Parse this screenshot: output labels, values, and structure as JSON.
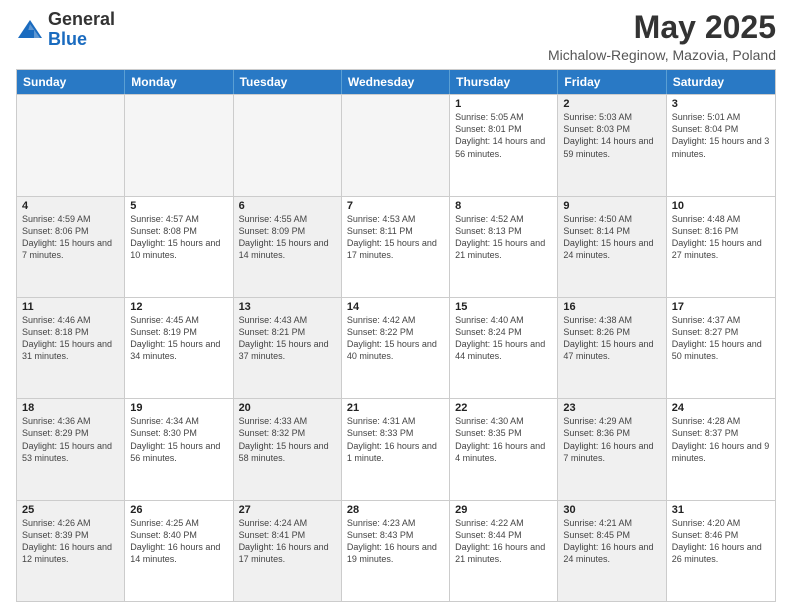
{
  "header": {
    "logo_general": "General",
    "logo_blue": "Blue",
    "month_year": "May 2025",
    "location": "Michalow-Reginow, Mazovia, Poland"
  },
  "days_of_week": [
    "Sunday",
    "Monday",
    "Tuesday",
    "Wednesday",
    "Thursday",
    "Friday",
    "Saturday"
  ],
  "weeks": [
    [
      {
        "day": "",
        "info": "",
        "shaded": true
      },
      {
        "day": "",
        "info": "",
        "shaded": true
      },
      {
        "day": "",
        "info": "",
        "shaded": true
      },
      {
        "day": "",
        "info": "",
        "shaded": true
      },
      {
        "day": "1",
        "info": "Sunrise: 5:05 AM\nSunset: 8:01 PM\nDaylight: 14 hours\nand 56 minutes.",
        "shaded": false
      },
      {
        "day": "2",
        "info": "Sunrise: 5:03 AM\nSunset: 8:03 PM\nDaylight: 14 hours\nand 59 minutes.",
        "shaded": true
      },
      {
        "day": "3",
        "info": "Sunrise: 5:01 AM\nSunset: 8:04 PM\nDaylight: 15 hours\nand 3 minutes.",
        "shaded": false
      }
    ],
    [
      {
        "day": "4",
        "info": "Sunrise: 4:59 AM\nSunset: 8:06 PM\nDaylight: 15 hours\nand 7 minutes.",
        "shaded": true
      },
      {
        "day": "5",
        "info": "Sunrise: 4:57 AM\nSunset: 8:08 PM\nDaylight: 15 hours\nand 10 minutes.",
        "shaded": false
      },
      {
        "day": "6",
        "info": "Sunrise: 4:55 AM\nSunset: 8:09 PM\nDaylight: 15 hours\nand 14 minutes.",
        "shaded": true
      },
      {
        "day": "7",
        "info": "Sunrise: 4:53 AM\nSunset: 8:11 PM\nDaylight: 15 hours\nand 17 minutes.",
        "shaded": false
      },
      {
        "day": "8",
        "info": "Sunrise: 4:52 AM\nSunset: 8:13 PM\nDaylight: 15 hours\nand 21 minutes.",
        "shaded": false
      },
      {
        "day": "9",
        "info": "Sunrise: 4:50 AM\nSunset: 8:14 PM\nDaylight: 15 hours\nand 24 minutes.",
        "shaded": true
      },
      {
        "day": "10",
        "info": "Sunrise: 4:48 AM\nSunset: 8:16 PM\nDaylight: 15 hours\nand 27 minutes.",
        "shaded": false
      }
    ],
    [
      {
        "day": "11",
        "info": "Sunrise: 4:46 AM\nSunset: 8:18 PM\nDaylight: 15 hours\nand 31 minutes.",
        "shaded": true
      },
      {
        "day": "12",
        "info": "Sunrise: 4:45 AM\nSunset: 8:19 PM\nDaylight: 15 hours\nand 34 minutes.",
        "shaded": false
      },
      {
        "day": "13",
        "info": "Sunrise: 4:43 AM\nSunset: 8:21 PM\nDaylight: 15 hours\nand 37 minutes.",
        "shaded": true
      },
      {
        "day": "14",
        "info": "Sunrise: 4:42 AM\nSunset: 8:22 PM\nDaylight: 15 hours\nand 40 minutes.",
        "shaded": false
      },
      {
        "day": "15",
        "info": "Sunrise: 4:40 AM\nSunset: 8:24 PM\nDaylight: 15 hours\nand 44 minutes.",
        "shaded": false
      },
      {
        "day": "16",
        "info": "Sunrise: 4:38 AM\nSunset: 8:26 PM\nDaylight: 15 hours\nand 47 minutes.",
        "shaded": true
      },
      {
        "day": "17",
        "info": "Sunrise: 4:37 AM\nSunset: 8:27 PM\nDaylight: 15 hours\nand 50 minutes.",
        "shaded": false
      }
    ],
    [
      {
        "day": "18",
        "info": "Sunrise: 4:36 AM\nSunset: 8:29 PM\nDaylight: 15 hours\nand 53 minutes.",
        "shaded": true
      },
      {
        "day": "19",
        "info": "Sunrise: 4:34 AM\nSunset: 8:30 PM\nDaylight: 15 hours\nand 56 minutes.",
        "shaded": false
      },
      {
        "day": "20",
        "info": "Sunrise: 4:33 AM\nSunset: 8:32 PM\nDaylight: 15 hours\nand 58 minutes.",
        "shaded": true
      },
      {
        "day": "21",
        "info": "Sunrise: 4:31 AM\nSunset: 8:33 PM\nDaylight: 16 hours\nand 1 minute.",
        "shaded": false
      },
      {
        "day": "22",
        "info": "Sunrise: 4:30 AM\nSunset: 8:35 PM\nDaylight: 16 hours\nand 4 minutes.",
        "shaded": false
      },
      {
        "day": "23",
        "info": "Sunrise: 4:29 AM\nSunset: 8:36 PM\nDaylight: 16 hours\nand 7 minutes.",
        "shaded": true
      },
      {
        "day": "24",
        "info": "Sunrise: 4:28 AM\nSunset: 8:37 PM\nDaylight: 16 hours\nand 9 minutes.",
        "shaded": false
      }
    ],
    [
      {
        "day": "25",
        "info": "Sunrise: 4:26 AM\nSunset: 8:39 PM\nDaylight: 16 hours\nand 12 minutes.",
        "shaded": true
      },
      {
        "day": "26",
        "info": "Sunrise: 4:25 AM\nSunset: 8:40 PM\nDaylight: 16 hours\nand 14 minutes.",
        "shaded": false
      },
      {
        "day": "27",
        "info": "Sunrise: 4:24 AM\nSunset: 8:41 PM\nDaylight: 16 hours\nand 17 minutes.",
        "shaded": true
      },
      {
        "day": "28",
        "info": "Sunrise: 4:23 AM\nSunset: 8:43 PM\nDaylight: 16 hours\nand 19 minutes.",
        "shaded": false
      },
      {
        "day": "29",
        "info": "Sunrise: 4:22 AM\nSunset: 8:44 PM\nDaylight: 16 hours\nand 21 minutes.",
        "shaded": false
      },
      {
        "day": "30",
        "info": "Sunrise: 4:21 AM\nSunset: 8:45 PM\nDaylight: 16 hours\nand 24 minutes.",
        "shaded": true
      },
      {
        "day": "31",
        "info": "Sunrise: 4:20 AM\nSunset: 8:46 PM\nDaylight: 16 hours\nand 26 minutes.",
        "shaded": false
      }
    ]
  ]
}
